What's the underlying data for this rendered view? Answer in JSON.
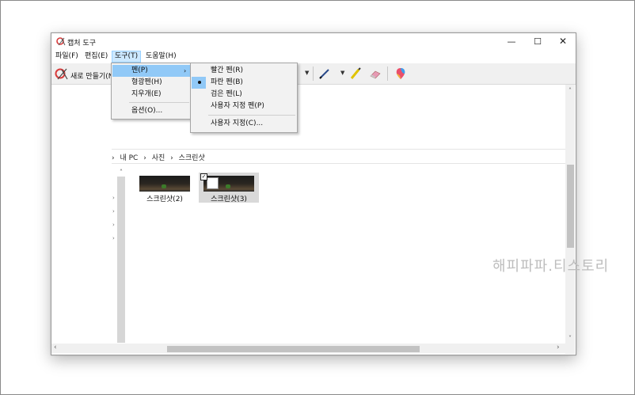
{
  "window": {
    "title": "캡처 도구",
    "controls": {
      "minimize": "—",
      "maximize": "☐",
      "close": "✕"
    }
  },
  "menubar": {
    "items": [
      "파일(F)",
      "편집(E)",
      "도구(T)",
      "도움말(H)"
    ]
  },
  "toolbar": {
    "new_label": "새로 만들기(N)"
  },
  "tools_menu": {
    "items": [
      "펜(P)",
      "형광펜(H)",
      "지우개(E)",
      "옵션(O)..."
    ]
  },
  "pen_submenu": {
    "items": [
      "빨간 펜(R)",
      "파란 펜(B)",
      "검은 펜(L)",
      "사용자 지정 펜(P)",
      "사용자 지정(C)..."
    ],
    "checked_item": "파란 펜(B)"
  },
  "explorer": {
    "breadcrumb": [
      "내 PC",
      "사진",
      "스크린샷"
    ],
    "files": [
      {
        "name": "스크린샷(2)"
      },
      {
        "name": "스크린샷(3)",
        "selected": true
      }
    ]
  },
  "watermark": "해피파파.티스토리",
  "colors": {
    "menu_highlight": "#91c9f7",
    "menubar_active": "#cce8ff",
    "toolbar_bg": "#f0f0f0",
    "watermark": "#bdbdbd"
  }
}
